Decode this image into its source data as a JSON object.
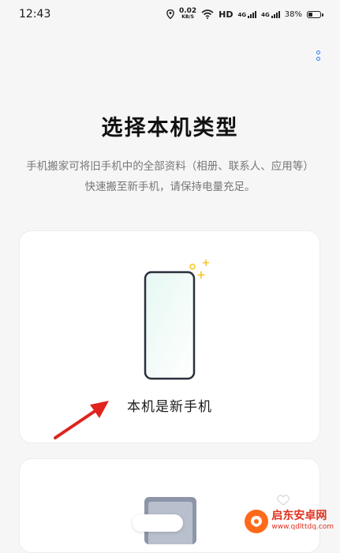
{
  "status_bar": {
    "time": "12:43",
    "speed_value": "0.02",
    "speed_unit": "KB/S",
    "hd_label": "HD",
    "signal1_label": "4G",
    "signal2_label": "4G",
    "battery_percent": "38%",
    "battery_level": 0.38
  },
  "header": {
    "menu_icon": "more-vertical-icon"
  },
  "main": {
    "title": "选择本机类型",
    "description": "手机搬家可将旧手机中的全部资料（相册、联系人、应用等）快速搬至新手机，请保持电量充足。"
  },
  "options": [
    {
      "label": "本机是新手机",
      "icon": "new-phone-illustration"
    },
    {
      "label": "",
      "icon": "old-phone-illustration"
    }
  ],
  "watermark": {
    "name": "启东安卓网",
    "url": "www.qdlttdq.com"
  },
  "colors": {
    "accent": "#2b7cff",
    "arrow": "#e0231d",
    "sparkle": "#f5c518"
  }
}
